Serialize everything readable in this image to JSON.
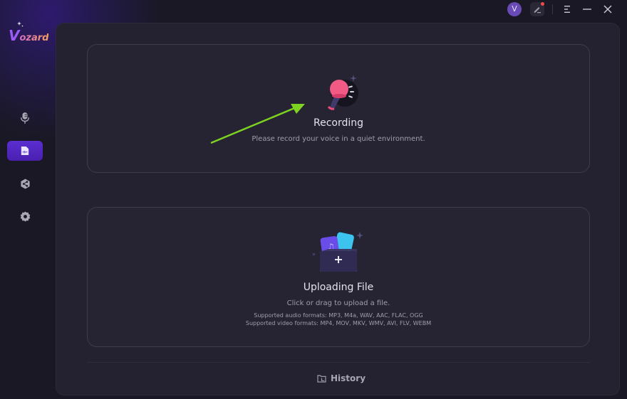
{
  "app": {
    "logo_first": "V",
    "logo_rest": "ozard"
  },
  "titlebar": {
    "avatar_initial": "V",
    "icons": [
      "feedback-edit-icon",
      "menu-icon",
      "minimize-icon",
      "close-icon"
    ],
    "notification_dot_color": "#ef4a4a"
  },
  "sidebar": {
    "items": [
      {
        "id": "voice",
        "icon": "microphone-icon",
        "active": false
      },
      {
        "id": "file",
        "icon": "audio-file-icon",
        "active": true
      },
      {
        "id": "share",
        "icon": "share-icon",
        "active": false
      },
      {
        "id": "settings",
        "icon": "gear-icon",
        "active": false
      }
    ],
    "accent": "#5a2ed0"
  },
  "recording": {
    "title": "Recording",
    "subtitle": "Please record your voice in a quiet environment."
  },
  "upload": {
    "title": "Uploading File",
    "subtitle": "Click or drag to upload a file.",
    "audio_formats": "Supported audio formats: MP3, M4a, WAV, AAC, FLAC, OGG",
    "video_formats": "Supported video formats: MP4, MOV, MKV, WMV, AVI, FLV, WEBM"
  },
  "footer": {
    "history_label": "History"
  },
  "annotation": {
    "arrow_color": "#7ed321"
  }
}
